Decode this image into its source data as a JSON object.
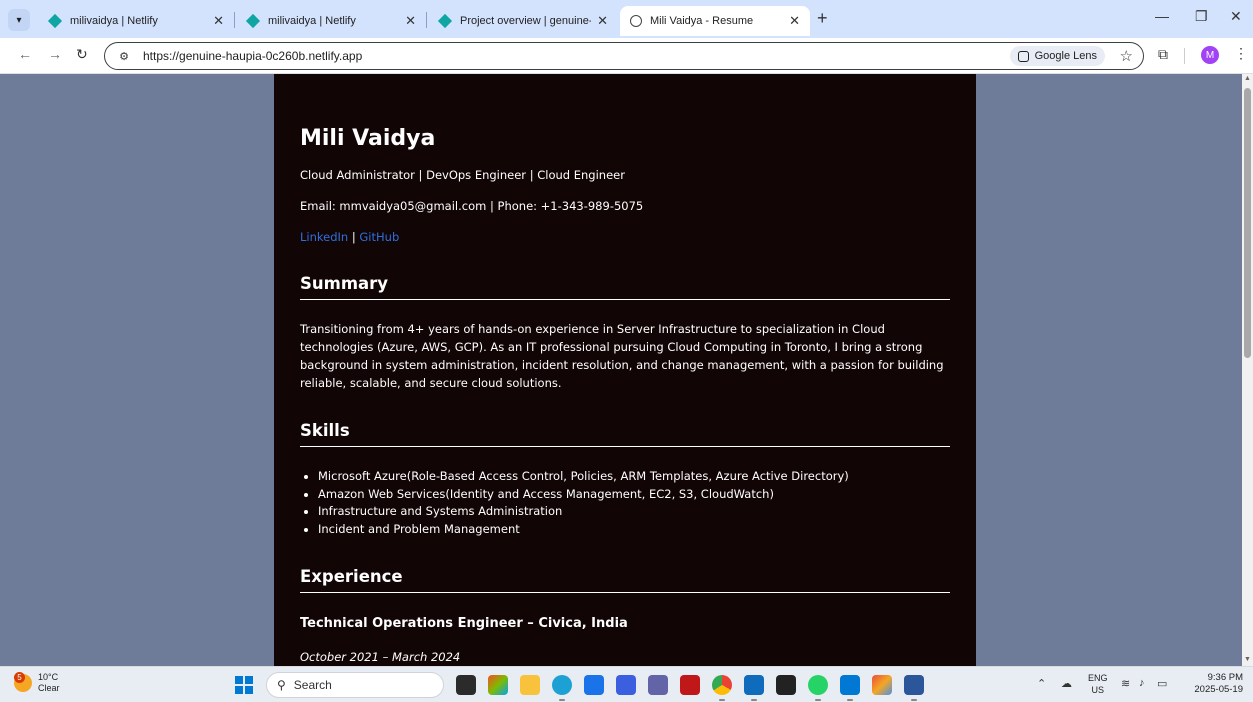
{
  "browser": {
    "tabs": [
      {
        "title": "milivaidya | Netlify",
        "icon": "netlify-icon"
      },
      {
        "title": "milivaidya | Netlify",
        "icon": "netlify-icon"
      },
      {
        "title": "Project overview | genuine-hau",
        "icon": "netlify-icon"
      },
      {
        "title": "Mili Vaidya - Resume",
        "icon": "globe-icon",
        "active": true
      }
    ],
    "url": "https://genuine-haupia-0c260b.netlify.app",
    "lens_label": "Google Lens",
    "profile_initial": "M"
  },
  "resume": {
    "name": "Mili Vaidya",
    "roles": "Cloud Administrator | DevOps Engineer | Cloud Engineer",
    "contact": "Email: mmvaidya05@gmail.com | Phone: +1-343-989-5075",
    "links": {
      "linkedin": "LinkedIn",
      "separator": "|",
      "github": "GitHub"
    },
    "summary_heading": "Summary",
    "summary_text": "Transitioning from 4+ years of hands-on experience in Server Infrastructure to specialization in Cloud technologies (Azure, AWS, GCP). As an IT professional pursuing Cloud Computing in Toronto, I bring a strong background in system administration, incident resolution, and change management, with a passion for building reliable, scalable, and secure cloud solutions.",
    "skills_heading": "Skills",
    "skills": [
      "Microsoft Azure(Role-Based Access Control, Policies, ARM Templates, Azure Active Directory)",
      "Amazon Web Services(Identity and Access Management, EC2, S3, CloudWatch)",
      "Infrastructure and Systems Administration",
      "Incident and Problem Management"
    ],
    "experience_heading": "Experience",
    "job_title": "Technical Operations Engineer – Civica, India",
    "job_dates": "October 2021 – March 2024"
  },
  "taskbar": {
    "weather_temp": "10°C",
    "weather_desc": "Clear",
    "weather_badge": "5",
    "search_placeholder": "Search",
    "lang_top": "ENG",
    "lang_bottom": "US",
    "time": "9:36 PM",
    "date": "2025-05-19"
  },
  "colors": {
    "page_bg": "#6f7c99",
    "resume_bg": "#120506",
    "link": "#2f6fdc",
    "tabstrip": "#d3e3fd"
  }
}
